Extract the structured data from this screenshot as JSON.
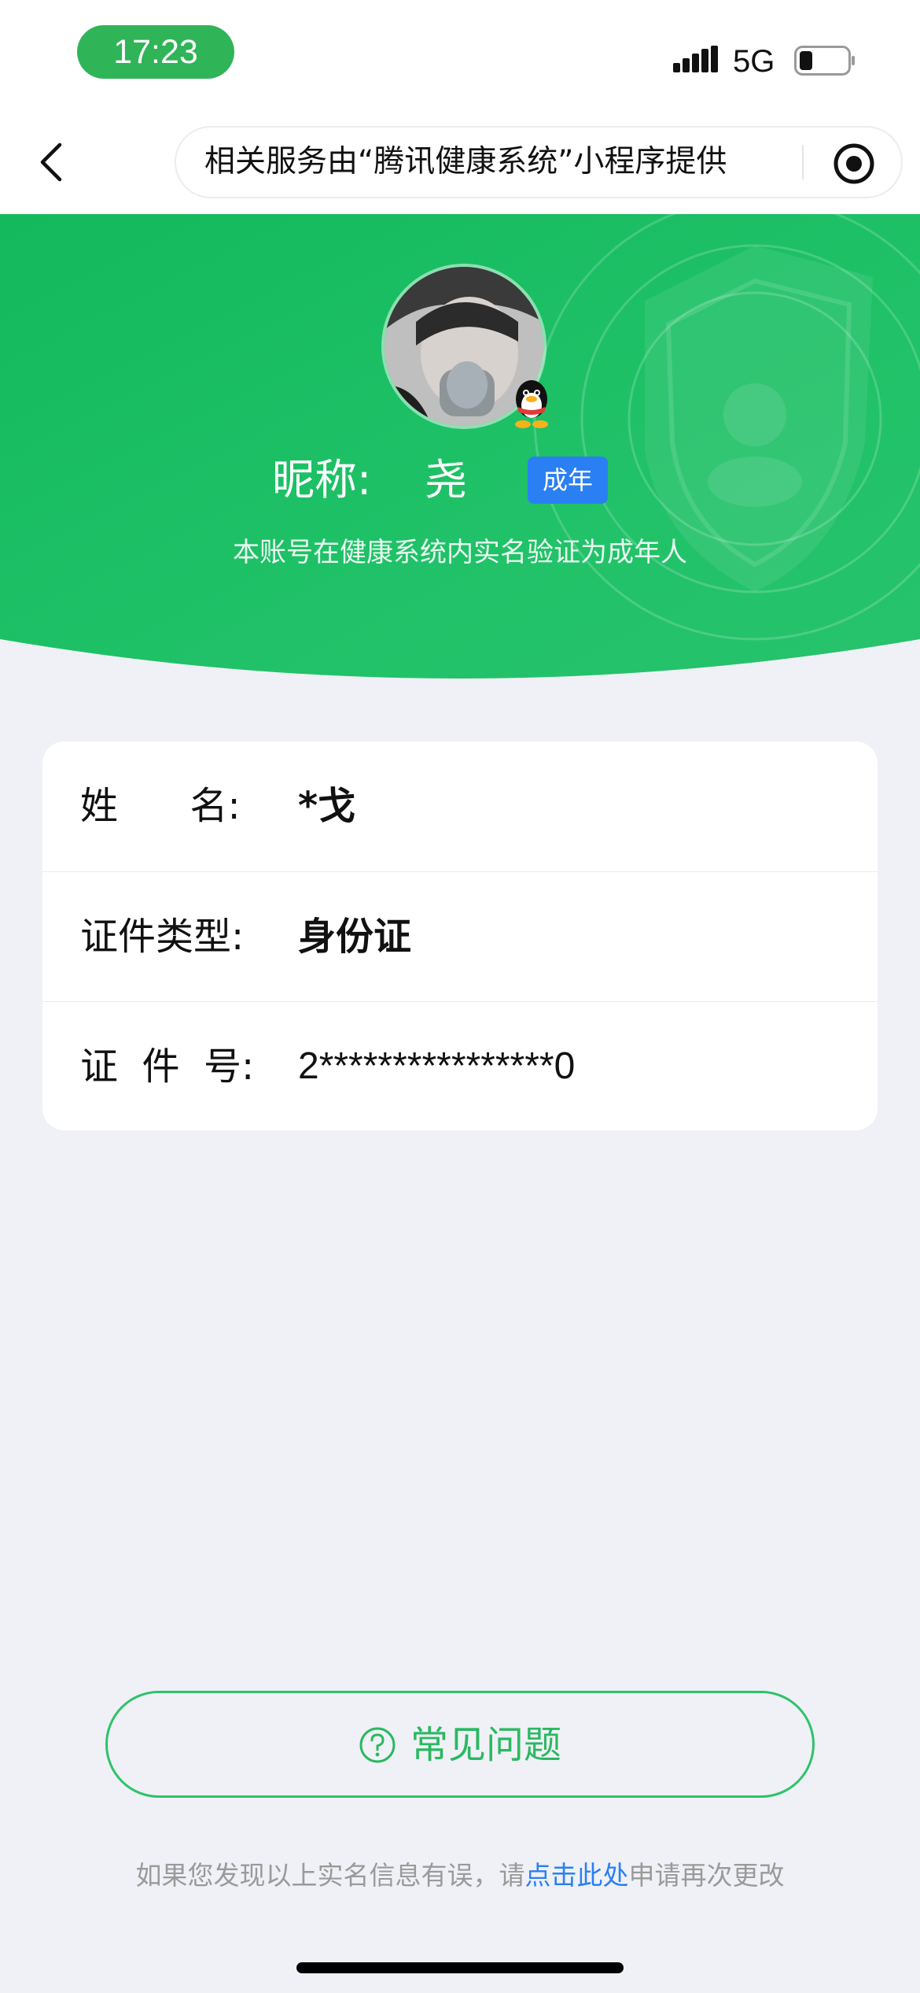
{
  "status_bar": {
    "time": "17:23",
    "network": "5G"
  },
  "nav": {
    "capsule_text": "相关服务由“腾讯健康系统”小程序提供"
  },
  "profile": {
    "nickname_label": "昵称:",
    "nickname": "尧",
    "badge": "成年",
    "verify_note": "本账号在健康系统内实名验证为成年人"
  },
  "info": {
    "rows": [
      {
        "label": "姓      名:",
        "value": "*戈"
      },
      {
        "label": "证件类型:",
        "value": "身份证"
      },
      {
        "label": "证  件  号:",
        "value": "2****************0"
      }
    ]
  },
  "faq": {
    "label": "常见问题"
  },
  "footer": {
    "prefix": "如果您发现以上实名信息有误，请",
    "link": "点击此处",
    "suffix": "申请再次更改"
  },
  "colors": {
    "accent_green": "#2fc26a",
    "hero_green": "#1fbd64",
    "link_blue": "#2a7ff3",
    "background": "#eff1f6"
  }
}
